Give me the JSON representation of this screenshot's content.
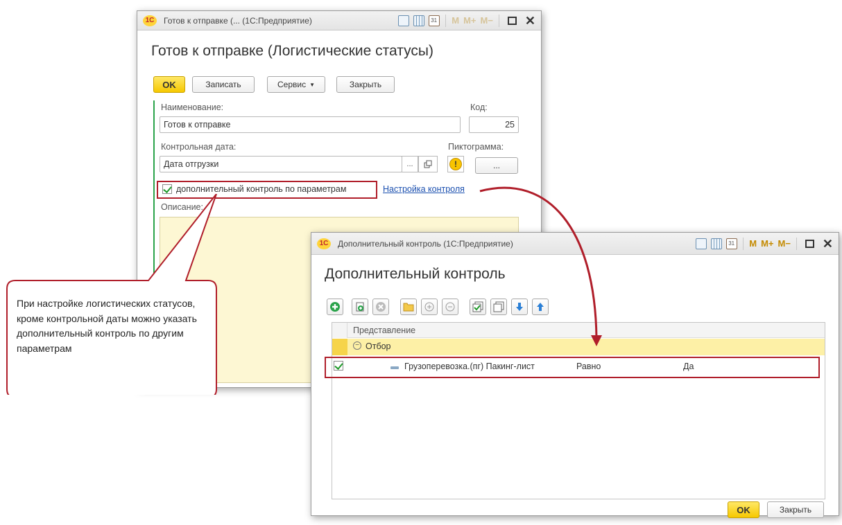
{
  "main_window": {
    "titlebar_text": "Готов к отправке (... (1С:Предприятие)",
    "logo_text": "1С",
    "m_labels": [
      "M",
      "M+",
      "M−"
    ],
    "heading": "Готов к отправке (Логистические статусы)",
    "buttons": {
      "ok": "OK",
      "save": "Записать",
      "service": "Сервис",
      "close": "Закрыть"
    },
    "name_label": "Наименование:",
    "name_value": "Готов к отправке",
    "code_label": "Код:",
    "code_value": "25",
    "control_date_label": "Контрольная дата:",
    "control_date_value": "Дата отгрузки",
    "pictogram_label": "Пиктограмма:",
    "pick_label": "...",
    "checkbox_label": "дополнительный контроль по параметрам",
    "settings_link": "Настройка контроля",
    "description_label": "Описание:"
  },
  "callout": {
    "text": "При настройке логистических статусов, кроме контрольной даты можно указать дополнительный контроль по другим параметрам"
  },
  "sub_window": {
    "titlebar_text": "Дополнительный контроль (1С:Предприятие)",
    "logo_text": "1С",
    "m_labels": [
      "M",
      "M+",
      "M−"
    ],
    "heading": "Дополнительный контроль",
    "grid": {
      "column_header": "Представление",
      "group_row": "Отбор",
      "rows": [
        {
          "field": "Грузоперевозка.(пг) Пакинг-лист",
          "condition": "Равно",
          "value": "Да",
          "checked": true
        }
      ]
    },
    "buttons": {
      "ok": "OK",
      "close": "Закрыть"
    }
  },
  "colors": {
    "accent_red": "#b01e2a",
    "ok_yellow": "#f6c800",
    "group_row": "#fdf0a6",
    "link": "#1a4faf"
  }
}
